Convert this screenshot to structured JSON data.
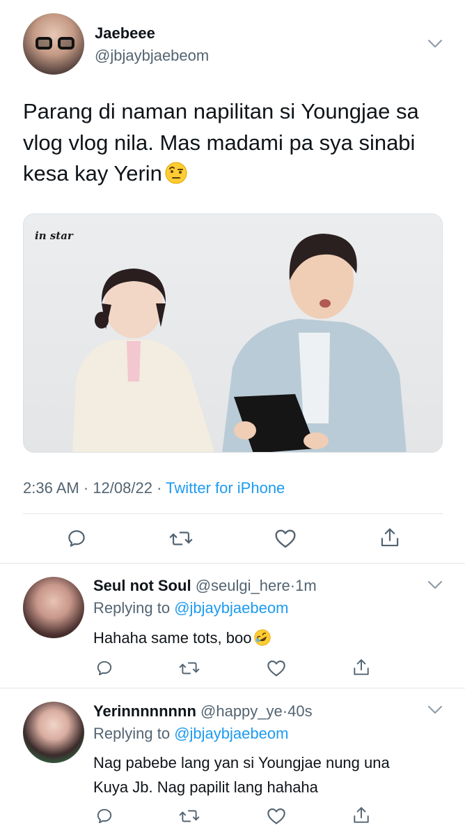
{
  "main_tweet": {
    "author": {
      "name": "Jaebeee",
      "handle": "@jbjaybjaebeom",
      "avatar_icon": "avatar-sunglasses"
    },
    "text": "Parang di naman napilitan si Youngjae sa vlog vlog nila. Mas madami pa sya sinabi kesa kay Yerin",
    "emoji": "face-with-raised-eyebrow",
    "media": {
      "watermark": "in star",
      "description_icon": "photo"
    },
    "meta": {
      "time": "2:36 AM",
      "dot1": "·",
      "date": "12/08/22",
      "dot2": "·",
      "source": "Twitter for iPhone"
    },
    "actions": [
      "reply-icon",
      "retweet-icon",
      "like-icon",
      "share-icon"
    ]
  },
  "replies": [
    {
      "name": "Seul not Soul",
      "handle": "@seulgi_here",
      "dot": "·",
      "time": "1m",
      "replying_prefix": "Replying to",
      "replying_to": "@jbjaybjaebeom",
      "text": "Hahaha same tots, boo",
      "emoji": "rolling-on-floor-laughing"
    },
    {
      "name": "Yerinnnnnnnn",
      "handle": "@happy_ye",
      "dot": "·",
      "time": "40s",
      "replying_prefix": "Replying to",
      "replying_to": "@jbjaybjaebeom",
      "text": "Nag pabebe lang yan si Youngjae nung una Kuya Jb. Nag papilit lang hahaha",
      "emoji": ""
    }
  ],
  "colors": {
    "text": "#0f1419",
    "secondary": "#536471",
    "link": "#1d9bf0",
    "divider": "#e1e6ea"
  }
}
